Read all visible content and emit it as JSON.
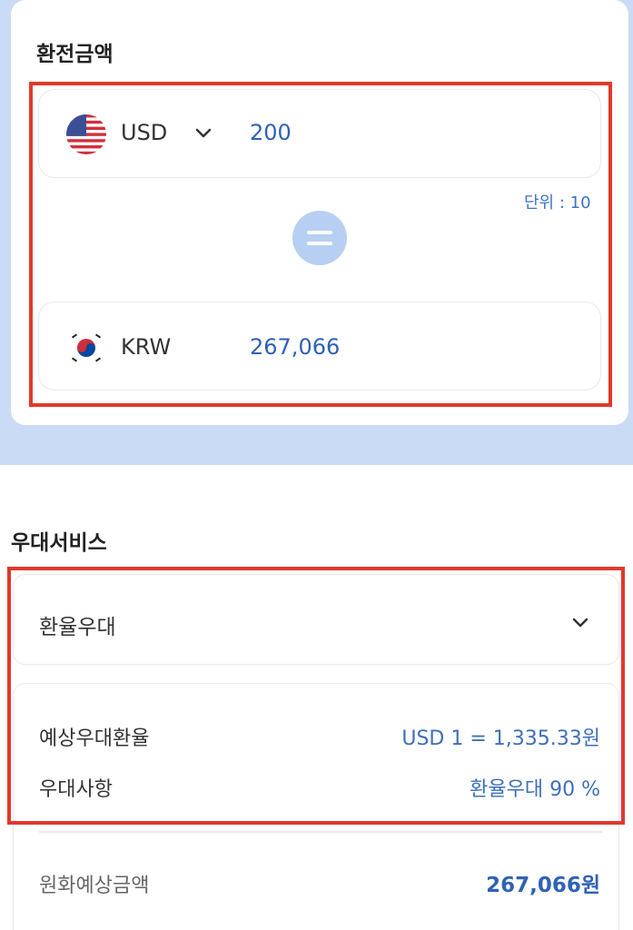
{
  "exchange": {
    "title": "환전금액",
    "from": {
      "code": "USD",
      "amount": "200",
      "flag": "us-flag-icon"
    },
    "unit_note": "단위 : 10",
    "to": {
      "code": "KRW",
      "amount": "267,066",
      "flag": "kr-flag-icon"
    }
  },
  "benefit": {
    "title": "우대서비스",
    "dropdown_label": "환율우대",
    "details": [
      {
        "label": "예상우대환율",
        "value": "USD 1 = 1,335.33원"
      },
      {
        "label": "우대사항",
        "value": "환율우대 90 %"
      }
    ],
    "total": {
      "label": "원화예상금액",
      "value": "267,066원"
    }
  },
  "colors": {
    "accent": "#2f62b5",
    "highlight": "#e0392b",
    "background": "#c9dbf5"
  }
}
